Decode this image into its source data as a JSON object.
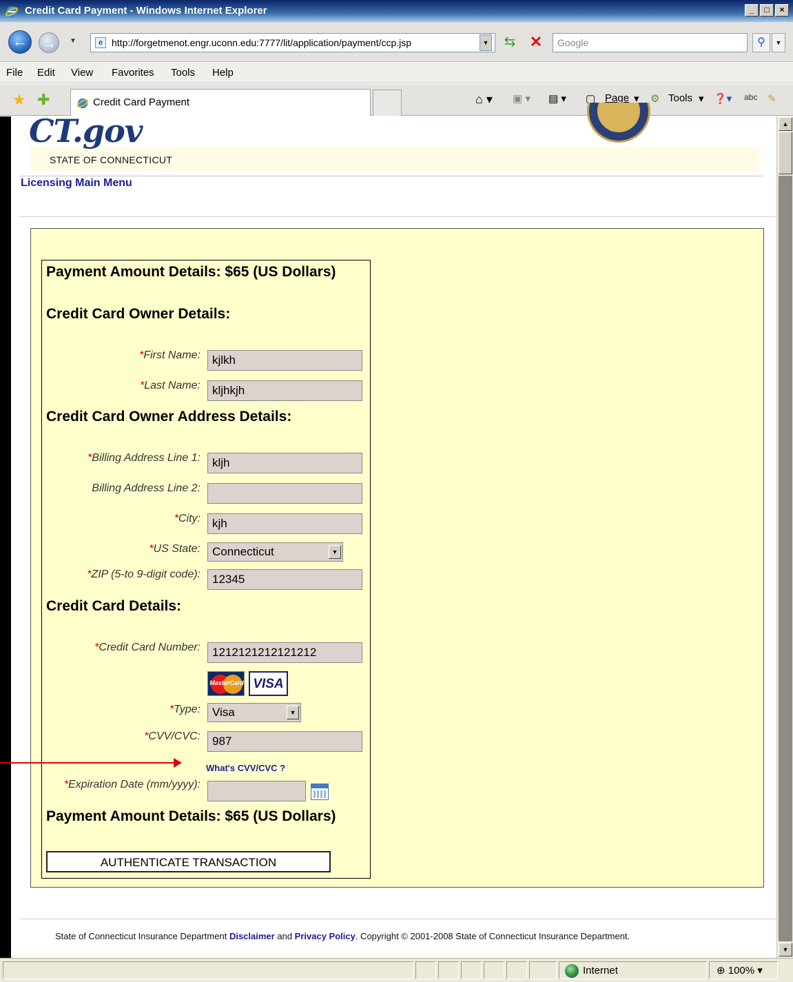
{
  "window": {
    "title": "Credit Card Payment - Windows Internet Explorer",
    "controls": {
      "minimize": "_",
      "maximize": "□",
      "close": "×"
    }
  },
  "address_bar": {
    "url": "http://forgetmenot.engr.uconn.edu:7777/lit/application/payment/ccp.jsp",
    "search_placeholder": "Google"
  },
  "menu": [
    "File",
    "Edit",
    "View",
    "Favorites",
    "Tools",
    "Help"
  ],
  "tab": {
    "title": "Credit Card Payment"
  },
  "command_bar": {
    "page_label": "Page",
    "tools_label": "Tools"
  },
  "header": {
    "logo_text": "CT.gov",
    "state_text": "STATE OF CONNECTICUT",
    "main_menu_link": "Licensing Main Menu"
  },
  "form": {
    "payment_heading_top": "Payment Amount Details: $65 (US Dollars)",
    "owner_heading": "Credit Card Owner Details:",
    "address_heading": "Credit Card Owner Address Details:",
    "card_heading": "Credit Card Details:",
    "payment_heading_bottom": "Payment Amount Details: $65 (US Dollars)",
    "required_marker": "*",
    "fields": {
      "first_name": {
        "label": "First Name:",
        "value": "kjlkh"
      },
      "last_name": {
        "label": "Last Name:",
        "value": "kljhkjh"
      },
      "billing_line1": {
        "label": "Billing Address Line 1:",
        "value": "kljh"
      },
      "billing_line2": {
        "label": "Billing Address Line 2:",
        "value": ""
      },
      "city": {
        "label": "City:",
        "value": "kjh"
      },
      "us_state": {
        "label": "US State:",
        "value": "Connecticut"
      },
      "zip": {
        "label": "ZIP (5-to 9-digit code):",
        "value": "12345"
      },
      "card_number": {
        "label": "Credit Card Number:",
        "value": "1212121212121212"
      },
      "type": {
        "label": "Type:",
        "value": "Visa"
      },
      "cvv": {
        "label": "CVV/CVC:",
        "value": "987"
      },
      "expiration": {
        "label": "Expiration Date (mm/yyyy):",
        "value": ""
      }
    },
    "card_logos": {
      "mastercard": "MasterCard",
      "visa": "VISA"
    },
    "cvv_help_link": "What's CVV/CVC ?",
    "submit_label": "AUTHENTICATE TRANSACTION"
  },
  "footer": {
    "text_before": "State of Connecticut Insurance Department",
    "disclaimer_link": "Disclaimer",
    "text_and": "and",
    "privacy_link": "Privacy Policy",
    "copyright": ".  Copyright © 2001-2008 State of Connecticut Insurance Department."
  },
  "status_bar": {
    "zone": "Internet",
    "zoom": "100%"
  }
}
